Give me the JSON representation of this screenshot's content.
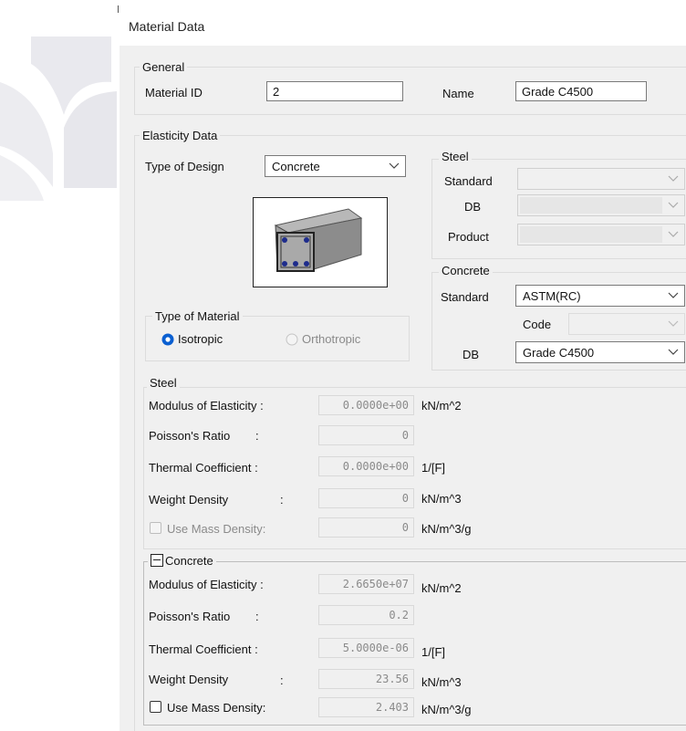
{
  "window": {
    "title": "Material Data"
  },
  "general": {
    "group_title": "General",
    "material_id_label": "Material ID",
    "material_id_value": "2",
    "name_label": "Name",
    "name_value": "Grade C4500"
  },
  "elasticity": {
    "group_title": "Elasticity Data",
    "type_of_design_label": "Type of Design",
    "type_of_design_value": "Concrete"
  },
  "steel_selector": {
    "group_title": "Steel",
    "standard_label": "Standard",
    "standard_value": "",
    "db_label": "DB",
    "db_value": "",
    "product_label": "Product",
    "product_value": ""
  },
  "concrete_selector": {
    "group_title": "Concrete",
    "standard_label": "Standard",
    "standard_value": "ASTM(RC)",
    "code_label": "Code",
    "code_value": "",
    "db_label": "DB",
    "db_value": "Grade C4500"
  },
  "material_type": {
    "group_title": "Type of Material",
    "isotropic_label": "Isotropic",
    "orthotropic_label": "Orthotropic",
    "selected": "Isotropic"
  },
  "steel_props": {
    "group_title": "Steel",
    "modulus_label": "Modulus of Elasticity :",
    "modulus_value": "0.0000e+00",
    "modulus_unit": "kN/m^2",
    "poisson_label": "Poisson's Ratio",
    "poisson_value": "0",
    "thermal_label": "Thermal Coefficient  :",
    "thermal_value": "0.0000e+00",
    "thermal_unit": "1/[F]",
    "weight_label": "Weight Density",
    "weight_value": "0",
    "weight_unit": "kN/m^3",
    "mass_label": "Use Mass Density:",
    "mass_value": "0",
    "mass_unit": "kN/m^3/g",
    "colon": ":"
  },
  "concrete_props": {
    "group_title": "Concrete",
    "modulus_label": "Modulus of Elasticity :",
    "modulus_value": "2.6650e+07",
    "modulus_unit": "kN/m^2",
    "poisson_label": "Poisson's Ratio",
    "poisson_value": "0.2",
    "thermal_label": "Thermal Coefficient  :",
    "thermal_value": "5.0000e-06",
    "thermal_unit": "1/[F]",
    "weight_label": "Weight Density",
    "weight_value": "23.56",
    "weight_unit": "kN/m^3",
    "mass_label": "Use Mass Density:",
    "mass_value": "2.403",
    "mass_unit": "kN/m^3/g",
    "colon": ":"
  }
}
